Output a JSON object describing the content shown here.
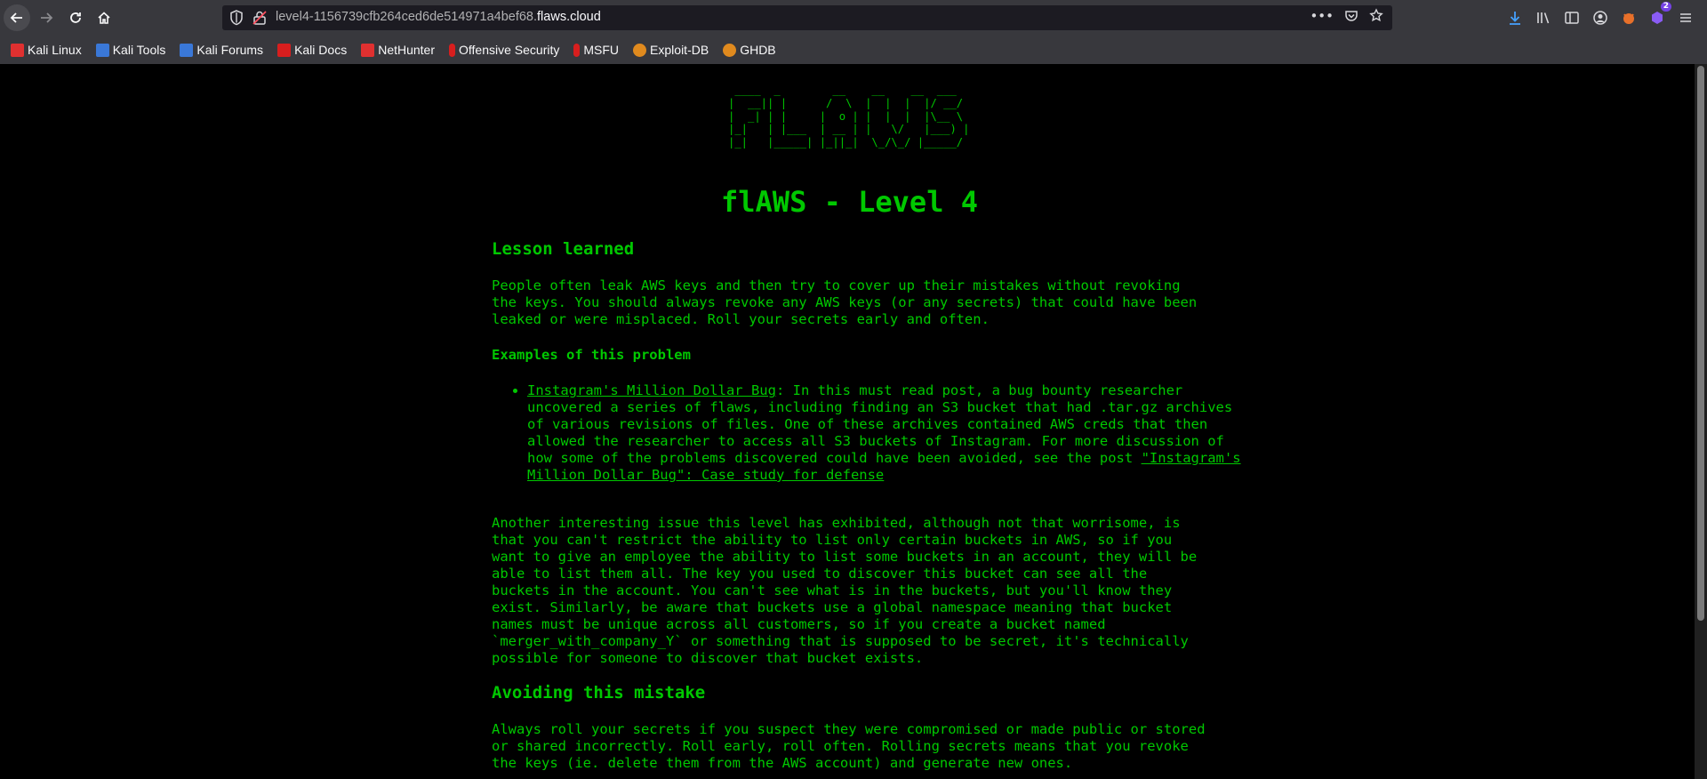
{
  "browser": {
    "url_prefix": "level4-1156739cfb264ced6de514971a4bef68.",
    "url_domain": "flaws.cloud",
    "bookmarks": [
      {
        "label": "Kali Linux",
        "color": "#e03030"
      },
      {
        "label": "Kali Tools",
        "color": "#3a78d8"
      },
      {
        "label": "Kali Forums",
        "color": "#3a78d8"
      },
      {
        "label": "Kali Docs",
        "color": "#d81e1e"
      },
      {
        "label": "NetHunter",
        "color": "#e03030"
      },
      {
        "label": "Offensive Security",
        "color": "#d81e1e"
      },
      {
        "label": "MSFU",
        "color": "#d81e1e"
      },
      {
        "label": "Exploit-DB",
        "color": "#e08a1e"
      },
      {
        "label": "GHDB",
        "color": "#e08a1e"
      }
    ],
    "extensions_badge": "2"
  },
  "page": {
    "logo_ascii": " ____  _        __    __    __  ___ \n|  __|| |      /  \\  |  |  |  |/ __/ \n|  _| | |     |  o | |  |  |  |\\__ \\ \n|_|   | |___  | __ | |   \\/   |___) |\n|_|   |_____| |_||_|  \\_/\\_/ |_____/ ",
    "title": "flAWS - Level 4",
    "lesson_heading": "Lesson learned",
    "lesson_para": "People often leak AWS keys and then try to cover up their mistakes without revoking the keys. You should always revoke any AWS keys (or any secrets) that could have been leaked or were misplaced. Roll your secrets early and often.",
    "examples_heading": "Examples of this problem",
    "example_link": "Instagram's Million Dollar Bug",
    "example_text": ": In this must read post, a bug bounty researcher uncovered a series of flaws, including finding an S3 bucket that had .tar.gz archives of various revisions of files. One of these archives contained AWS creds that then allowed the researcher to access all S3 buckets of Instagram. For more discussion of how some of the problems discovered could have been avoided, see the post ",
    "example_link2": "\"Instagram's Million Dollar Bug\": Case study for defense",
    "interesting_para": "Another interesting issue this level has exhibited, although not that worrisome, is that you can't restrict the ability to list only certain buckets in AWS, so if you want to give an employee the ability to list some buckets in an account, they will be able to list them all. The key you used to discover this bucket can see all the buckets in the account. You can't see what is in the buckets, but you'll know they exist. Similarly, be aware that buckets use a global namespace meaning that bucket names must be unique across all customers, so if you create a bucket named `merger_with_company_Y` or something that is supposed to be secret, it's technically possible for someone to discover that bucket exists.",
    "avoid_heading": "Avoiding this mistake",
    "avoid_para": "Always roll your secrets if you suspect they were compromised or made public or stored or shared incorrectly. Roll early, roll often. Rolling secrets means that you revoke the keys (ie. delete them from the AWS account) and generate new ones."
  }
}
